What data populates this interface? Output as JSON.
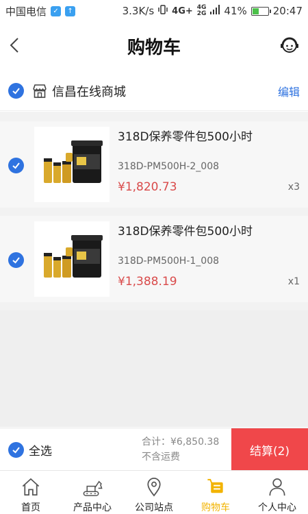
{
  "status_bar": {
    "carrier": "中国电信",
    "speed": "3.3K/s",
    "net_4g": "4G+",
    "net_small_a": "4G",
    "net_small_b": "2G",
    "battery": "41%",
    "battery_level": 0.41,
    "time": "20:47"
  },
  "header": {
    "title": "购物车",
    "back_icon": "chevron-left-icon",
    "service_icon": "customer-service-icon"
  },
  "store": {
    "name": "信昌在线商城",
    "edit_label": "编辑",
    "icon": "storefront-icon"
  },
  "cart": {
    "items": [
      {
        "title": "318D保养零件包500小时",
        "sku": "318D-PM500H-2_008",
        "price": "¥1,820.73",
        "qty": "x3"
      },
      {
        "title": "318D保养零件包500小时",
        "sku": "318D-PM500H-1_008",
        "price": "¥1,388.19",
        "qty": "x1"
      }
    ]
  },
  "summary": {
    "select_all_label": "全选",
    "total_text": "合计：¥6,850.38",
    "shipping_note": "不含运费",
    "checkout_label": "结算(2)"
  },
  "tabs": [
    {
      "label": "首页",
      "icon": "home-icon",
      "active": false
    },
    {
      "label": "产品中心",
      "icon": "excavator-icon",
      "active": false
    },
    {
      "label": "公司站点",
      "icon": "location-pin-icon",
      "active": false
    },
    {
      "label": "购物车",
      "icon": "cart-icon",
      "active": true
    },
    {
      "label": "个人中心",
      "icon": "user-icon",
      "active": false
    }
  ],
  "colors": {
    "accent_blue": "#2f73e0",
    "price_red": "#d94a4a",
    "checkout_red": "#f0474a",
    "active_tab": "#f2b300"
  }
}
